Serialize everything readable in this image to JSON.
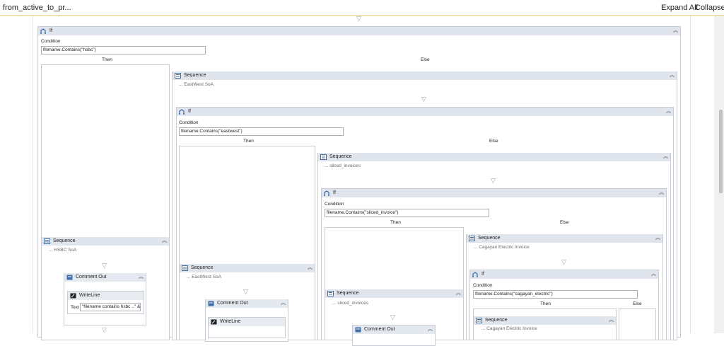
{
  "window": {
    "title": "from_active_to_pr...",
    "expand_all": "Expand All",
    "collapse_all": "Collapse A"
  },
  "labels": {
    "if": "If",
    "condition": "Condition",
    "then": "Then",
    "else": "Else",
    "sequence": "Sequence",
    "comment_out": "Comment Out",
    "writeline": "WriteLine",
    "text": "Text"
  },
  "conditions": {
    "hsbc": "filename.Contains(\"hsbc\")",
    "eastwest": "filename.Contains(\"eastwest\")",
    "sliced_invoice": "filename.Contains(\"sliced_invoice\")",
    "cagayan_electric": "filename.Contains(\"cagayan_electric\")"
  },
  "annotations": {
    "eastwest_soa": "... EastWest SoA",
    "sliced_invoices": "... sliced_invoices",
    "cagayan_electric_invoice": "... Cagayan Electric Invoice",
    "hsbc_soa": "... HSBC SoA"
  },
  "writeline_text": "\"filename contains hsbc ..\" &",
  "icons": {
    "if": "if-branch-icon",
    "sequence": "sequence-icon",
    "comment_out": "comment-out-icon",
    "writeline": "writeline-icon",
    "collapse": "chevron-up-icon",
    "drop": "drop-target-triangle-icon"
  }
}
